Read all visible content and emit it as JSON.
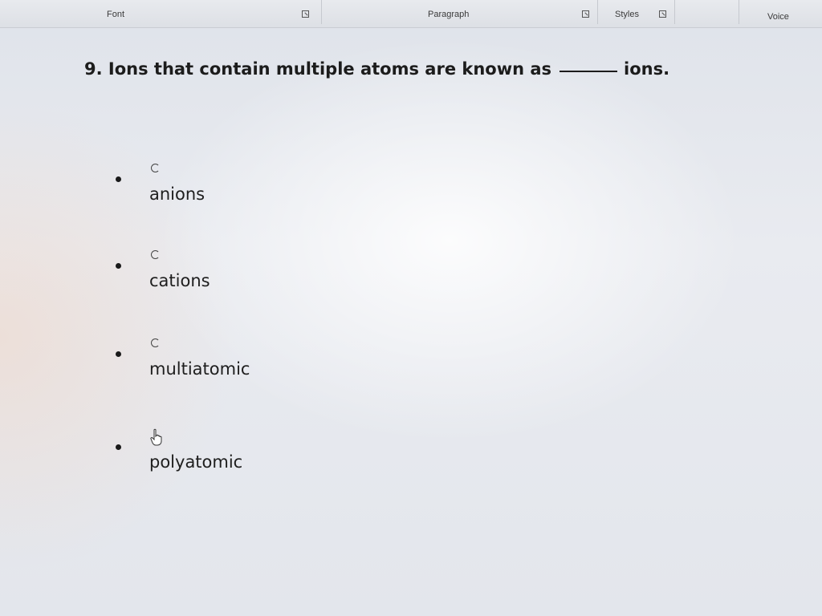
{
  "ribbon": {
    "groups": [
      {
        "label": "Font"
      },
      {
        "label": "Paragraph"
      },
      {
        "label": "Styles"
      },
      {
        "label": "Voice"
      }
    ]
  },
  "question": {
    "number_and_text": "9. Ions that contain multiple atoms are known as",
    "suffix": "ions."
  },
  "options": [
    {
      "label": "anions",
      "icon": "radio-icon"
    },
    {
      "label": "cations",
      "icon": "radio-icon"
    },
    {
      "label": "multiatomic",
      "icon": "radio-icon"
    },
    {
      "label": "polyatomic",
      "icon": "hand-cursor-icon"
    }
  ]
}
